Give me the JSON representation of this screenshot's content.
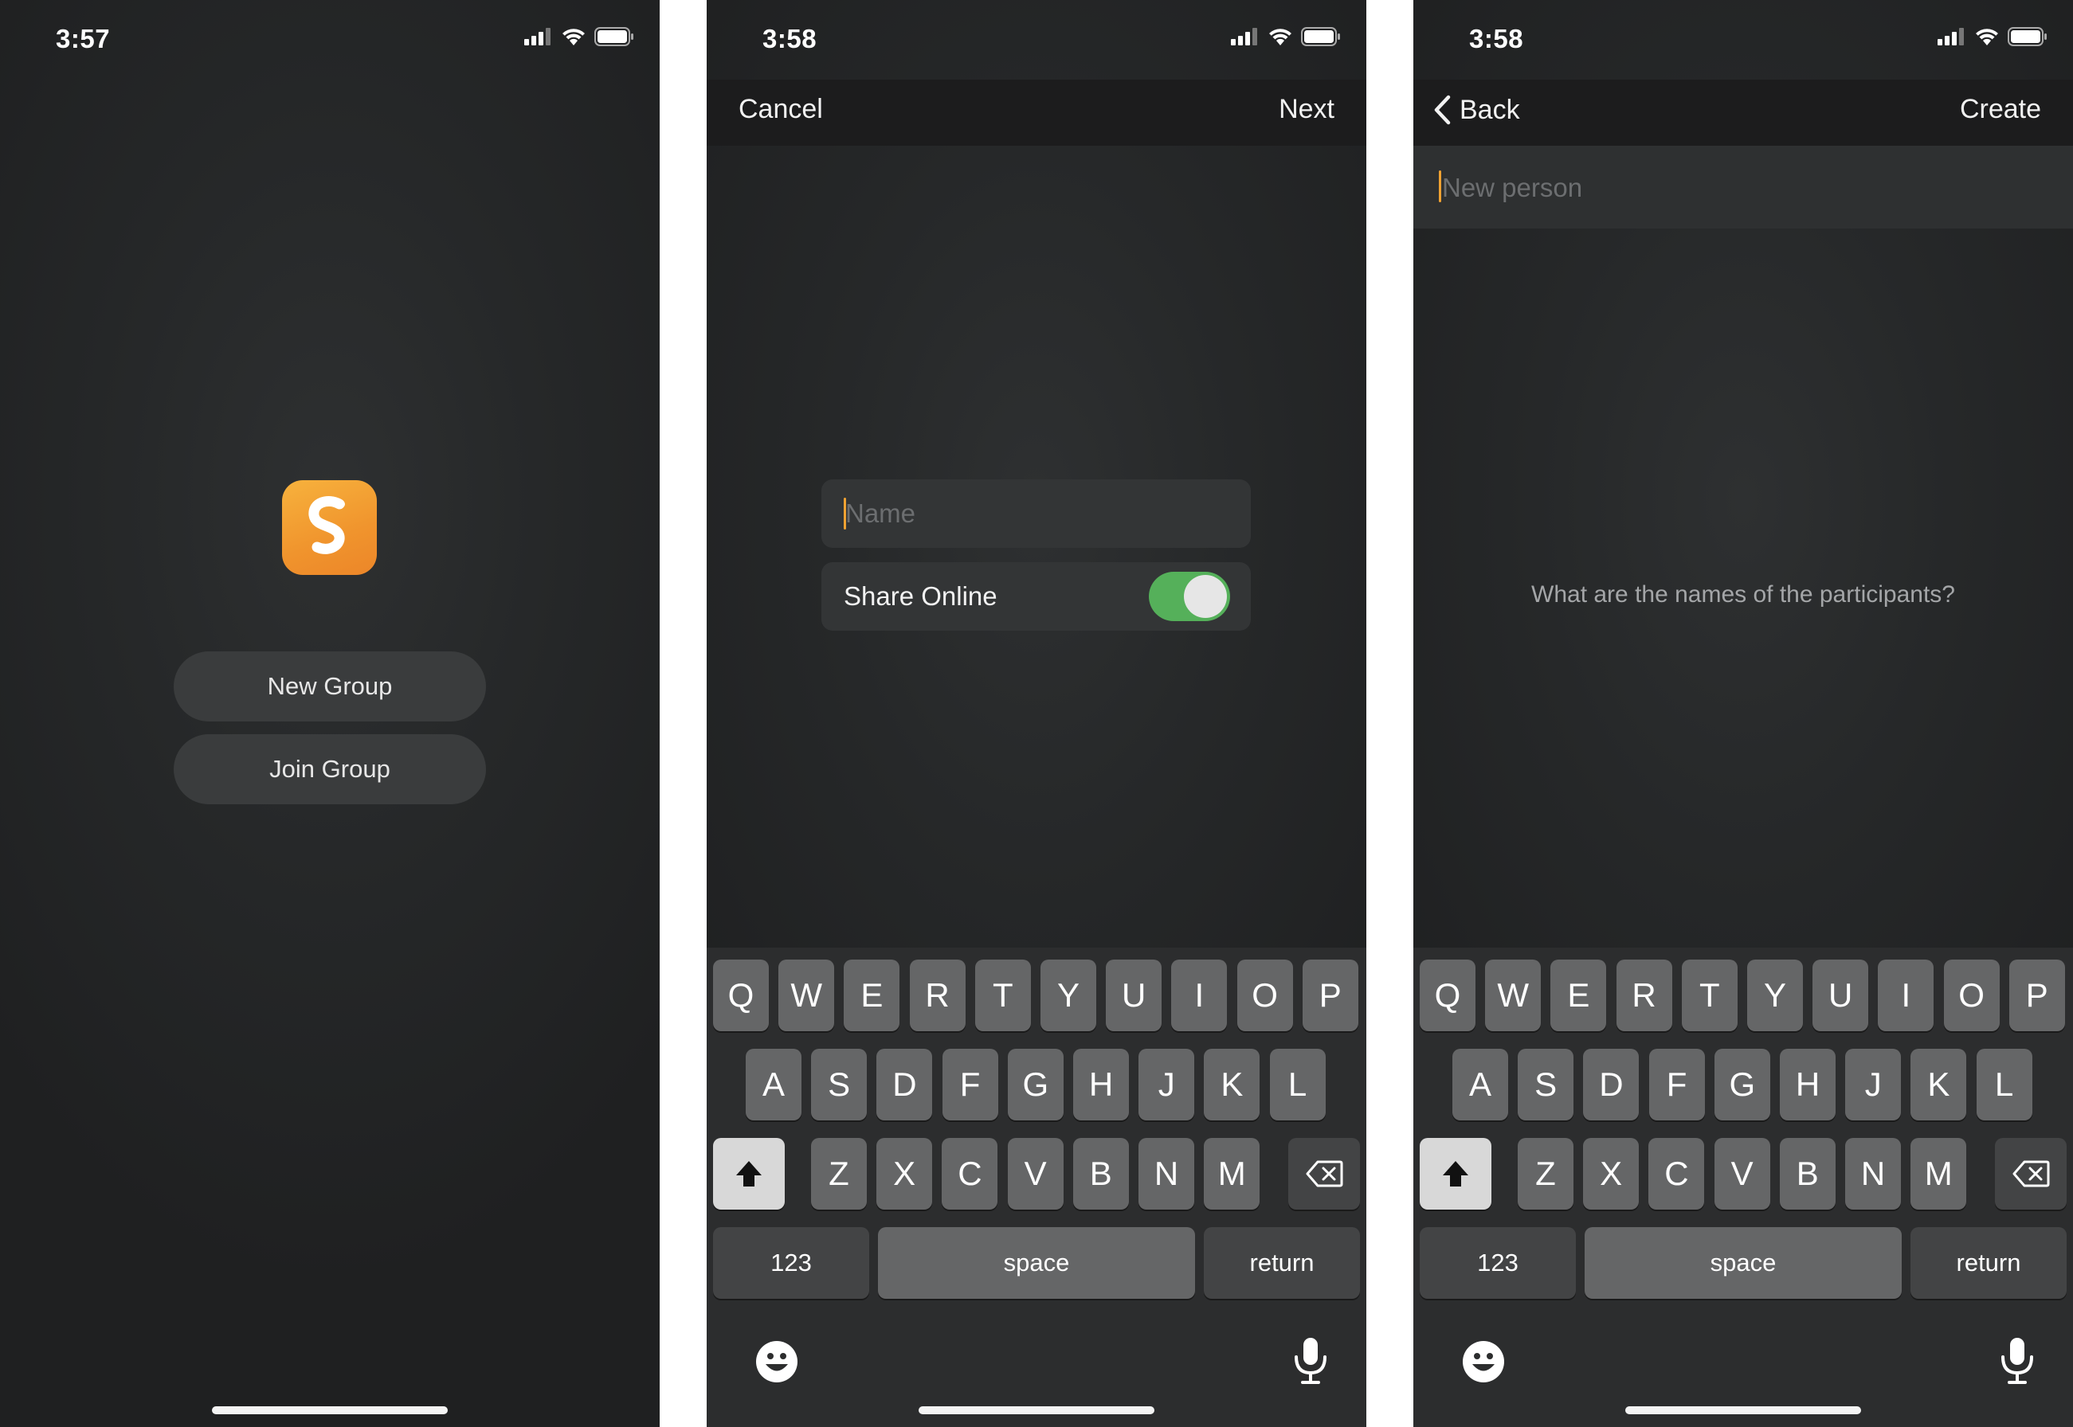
{
  "screens": [
    {
      "status": {
        "time": "3:57"
      },
      "buttons": {
        "new_group": "New Group",
        "join_group": "Join Group"
      }
    },
    {
      "status": {
        "time": "3:58"
      },
      "nav": {
        "left": "Cancel",
        "right": "Next"
      },
      "name_field": {
        "placeholder": "Name"
      },
      "share_online": {
        "label": "Share Online",
        "enabled": true
      }
    },
    {
      "status": {
        "time": "3:58"
      },
      "nav": {
        "left": "Back",
        "right": "Create"
      },
      "person_field": {
        "placeholder": "New person"
      },
      "prompt": "What are the names of the participants?"
    }
  ],
  "keyboard": {
    "row1": [
      "Q",
      "W",
      "E",
      "R",
      "T",
      "Y",
      "U",
      "I",
      "O",
      "P"
    ],
    "row2": [
      "A",
      "S",
      "D",
      "F",
      "G",
      "H",
      "J",
      "K",
      "L"
    ],
    "row3": [
      "Z",
      "X",
      "C",
      "V",
      "B",
      "N",
      "M"
    ],
    "numbers_key": "123",
    "space_key": "space",
    "return_key": "return"
  },
  "colors": {
    "accent": "#F0A232",
    "toggle_on": "#55B05A",
    "background": "#252728",
    "key": "#656667"
  },
  "icons": [
    "signal-icon",
    "wifi-icon",
    "battery-icon",
    "app-logo-icon",
    "back-chevron-icon",
    "shift-icon",
    "delete-icon",
    "emoji-icon",
    "microphone-icon"
  ]
}
